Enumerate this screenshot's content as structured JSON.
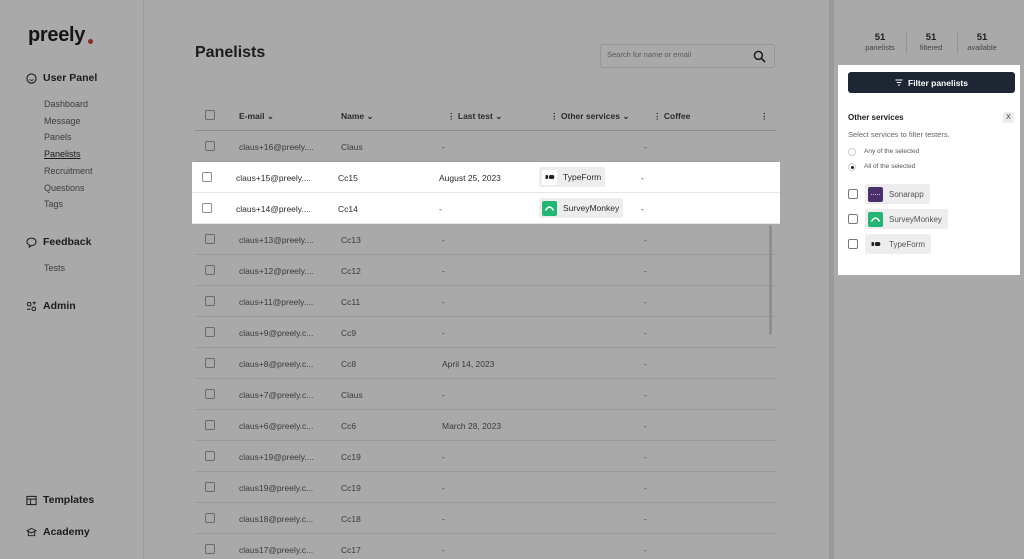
{
  "app": {
    "logo": "preely"
  },
  "sidebar": {
    "sections": [
      {
        "label": "User Panel",
        "icon": "smiley-icon",
        "items": [
          "Dashboard",
          "Message",
          "Panels",
          "Panelists",
          "Recruitment",
          "Questions",
          "Tags"
        ],
        "active": "Panelists"
      },
      {
        "label": "Feedback",
        "icon": "speech-bubble-icon",
        "items": [
          "Tests"
        ]
      },
      {
        "label": "Admin",
        "icon": "admin-icon",
        "items": []
      }
    ],
    "bottom": [
      {
        "label": "Templates",
        "icon": "templates-icon"
      },
      {
        "label": "Academy",
        "icon": "academy-icon"
      }
    ]
  },
  "main": {
    "title": "Panelists",
    "search_placeholder": "Search for name or email",
    "columns": {
      "email": "E-mail",
      "name": "Name",
      "last_test": "Last test",
      "other_services": "Other services",
      "coffee": "Coffee"
    },
    "rows": [
      {
        "email": "claus+16@preely....",
        "name": "Claus",
        "last_test": "-",
        "service": "",
        "coffee": "-",
        "highlight": false
      },
      {
        "email": "claus+15@preely....",
        "name": "Cc15",
        "last_test": "August 25, 2023",
        "service": "TypeForm",
        "coffee": "-",
        "highlight": true
      },
      {
        "email": "claus+14@preely....",
        "name": "Cc14",
        "last_test": "-",
        "service": "SurveyMonkey",
        "coffee": "-",
        "highlight": true
      },
      {
        "email": "claus+13@preely....",
        "name": "Cc13",
        "last_test": "-",
        "service": "",
        "coffee": "-",
        "highlight": false
      },
      {
        "email": "claus+12@preely....",
        "name": "Cc12",
        "last_test": "-",
        "service": "",
        "coffee": "-",
        "highlight": false
      },
      {
        "email": "claus+11@preely....",
        "name": "Cc11",
        "last_test": "-",
        "service": "",
        "coffee": "-",
        "highlight": false
      },
      {
        "email": "claus+9@preely.c...",
        "name": "Cc9",
        "last_test": "-",
        "service": "",
        "coffee": "-",
        "highlight": false
      },
      {
        "email": "claus+8@preely.c...",
        "name": "Cc8",
        "last_test": "April 14, 2023",
        "service": "",
        "coffee": "-",
        "highlight": false
      },
      {
        "email": "claus+7@preely.c...",
        "name": "Claus",
        "last_test": "-",
        "service": "",
        "coffee": "-",
        "highlight": false
      },
      {
        "email": "claus+6@preely.c...",
        "name": "Cc6",
        "last_test": "March 28, 2023",
        "service": "",
        "coffee": "-",
        "highlight": false
      },
      {
        "email": "claus+19@preely....",
        "name": "Cc19",
        "last_test": "-",
        "service": "",
        "coffee": "-",
        "highlight": false
      },
      {
        "email": "claus19@preely.c...",
        "name": "Cc19",
        "last_test": "-",
        "service": "",
        "coffee": "-",
        "highlight": false
      },
      {
        "email": "claus18@preely.c...",
        "name": "Cc18",
        "last_test": "-",
        "service": "",
        "coffee": "-",
        "highlight": false
      },
      {
        "email": "claus17@preely.c...",
        "name": "Cc17",
        "last_test": "-",
        "service": "",
        "coffee": "-",
        "highlight": false
      }
    ]
  },
  "stats": [
    {
      "value": "51",
      "label": "panelists"
    },
    {
      "value": "51",
      "label": "filtered"
    },
    {
      "value": "51",
      "label": "available"
    }
  ],
  "filter": {
    "button_label": "Filter panelists",
    "title": "Other services",
    "close_label": "X",
    "subtitle": "Select services to filter testers.",
    "modes": [
      {
        "label": "Any of the selected",
        "selected": false
      },
      {
        "label": "All of the selected",
        "selected": true
      }
    ],
    "options": [
      {
        "label": "Sonarapp",
        "logo_color": "#4a2f6b"
      },
      {
        "label": "SurveyMonkey",
        "logo_color": "#22b573"
      },
      {
        "label": "TypeForm",
        "logo_color": "#ededed"
      }
    ]
  },
  "colors": {
    "overlay": "#a9a9a9",
    "primary_button": "#1f2633",
    "surveymonkey": "#22b573",
    "sonarapp": "#4a2f6b",
    "logo_dot": "#c0392b"
  }
}
